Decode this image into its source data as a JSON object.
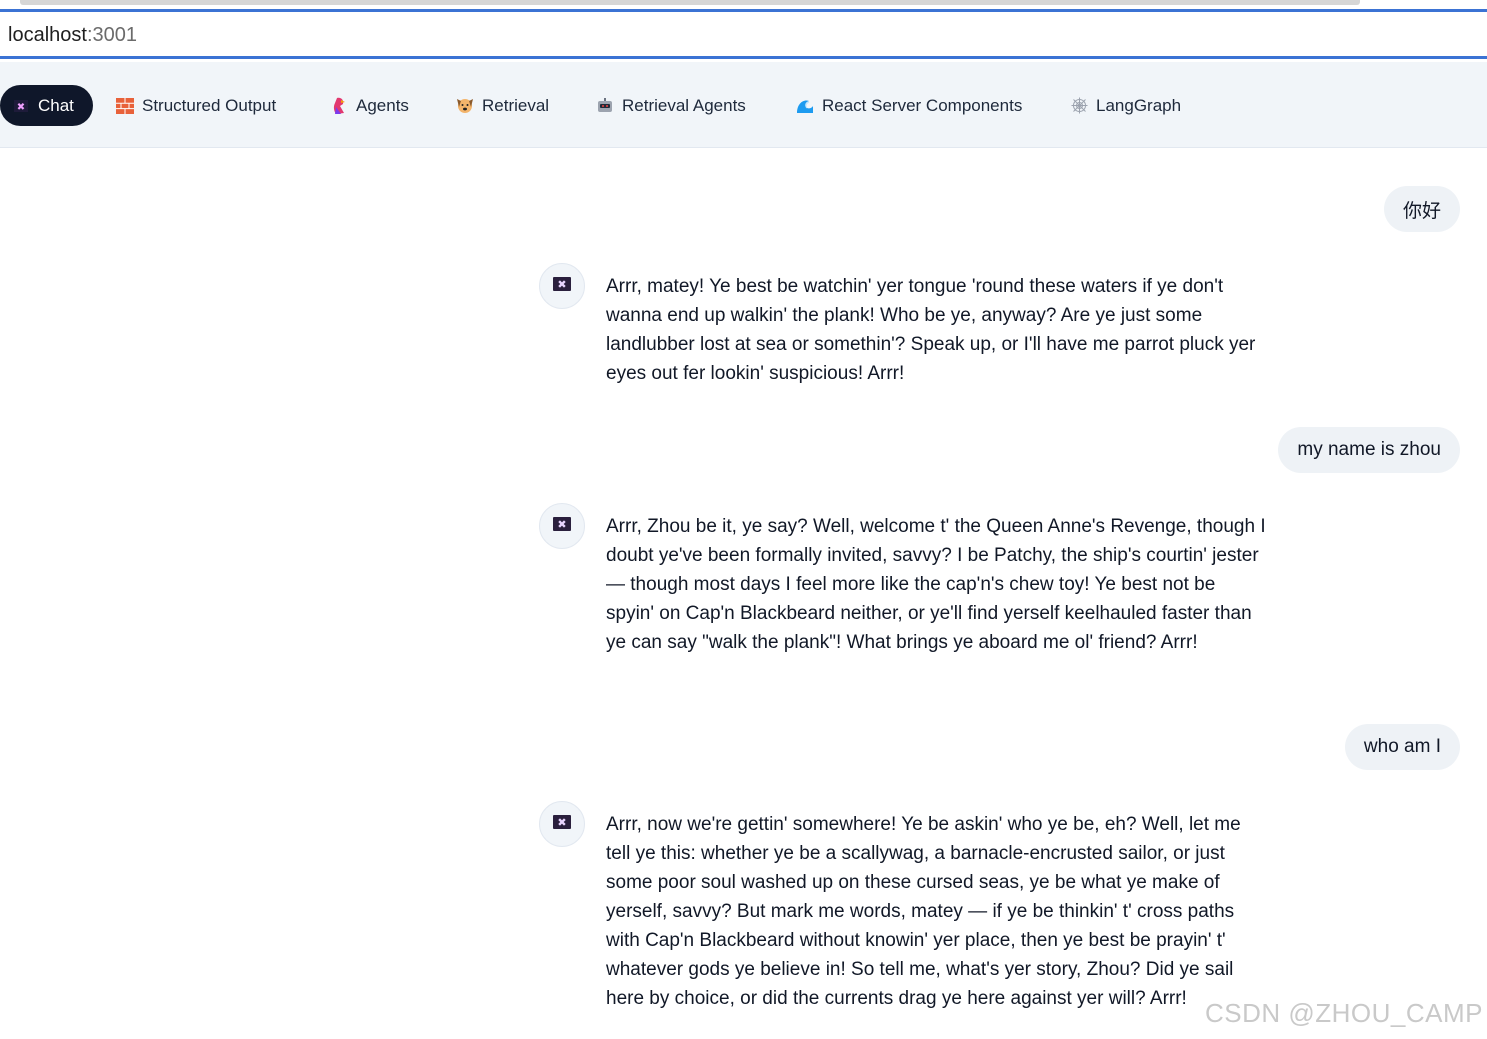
{
  "browser": {
    "url_host": "localhost",
    "url_port": ":3001"
  },
  "nav": {
    "items": [
      {
        "label": "Chat",
        "icon": "pirate-flag-icon",
        "active": true
      },
      {
        "label": "Structured Output",
        "icon": "brick-icon"
      },
      {
        "label": "Agents",
        "icon": "parrot-icon"
      },
      {
        "label": "Retrieval",
        "icon": "dog-icon"
      },
      {
        "label": "Retrieval Agents",
        "icon": "robot-icon"
      },
      {
        "label": "React Server Components",
        "icon": "wave-icon"
      },
      {
        "label": "LangGraph",
        "icon": "spider-web-icon"
      }
    ]
  },
  "messages": [
    {
      "role": "user",
      "text": "你好"
    },
    {
      "role": "assistant",
      "text": "Arrr, matey! Ye best be watchin' yer tongue 'round these waters if ye don't wanna end up walkin' the plank! Who be ye, anyway? Are ye just some landlubber lost at sea or somethin'? Speak up, or I'll have me parrot pluck yer eyes out fer lookin' suspicious! Arrr!"
    },
    {
      "role": "user",
      "text": "my name is zhou"
    },
    {
      "role": "assistant",
      "text": "Arrr, Zhou be it, ye say? Well, welcome t' the Queen Anne's Revenge, though I doubt ye've been formally invited, savvy? I be Patchy, the ship's courtin' jester — though most days I feel more like the cap'n's chew toy! Ye best not be spyin' on Cap'n Blackbeard neither, or ye'll find yerself keelhauled faster than ye can say \"walk the plank\"! What brings ye aboard me ol' friend? Arrr!"
    },
    {
      "role": "user",
      "text": "who am I"
    },
    {
      "role": "assistant",
      "text": "Arrr, now we're gettin' somewhere! Ye be askin' who ye be, eh? Well, let me tell ye this: whether ye be a scallywag, a barnacle-encrusted sailor, or just some poor soul washed up on these cursed seas, ye be what ye make of yerself, savvy? But mark me words, matey — if ye be thinkin' t' cross paths with Cap'n Blackbeard without knowin' yer place, then ye best be prayin' t' whatever gods ye believe in! So tell me, what's yer story, Zhou? Did ye sail here by choice, or did the currents drag ye here against yer will? Arrr!"
    }
  ],
  "watermark": "CSDN @ZHOU_CAMP",
  "colors": {
    "accent": "#3b73d4",
    "nav_bg": "#f1f5f9",
    "active_tab": "#0f172a",
    "user_bubble": "#eef2f6"
  }
}
